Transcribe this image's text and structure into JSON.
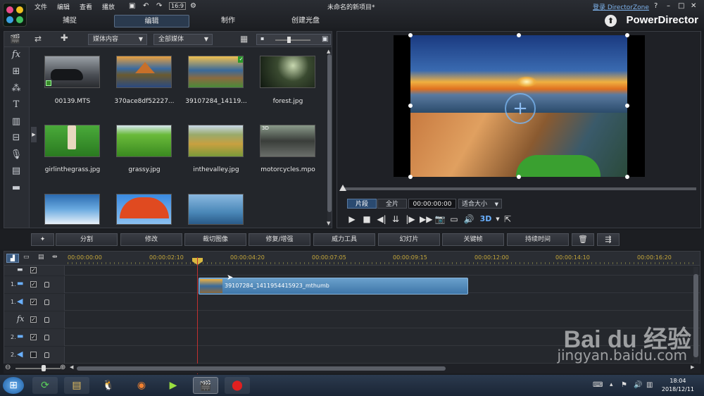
{
  "window": {
    "title": "未命名的新项目*",
    "menus": [
      "文件",
      "编辑",
      "查看",
      "播放"
    ],
    "login": "登录 DirectorZone",
    "help": "?"
  },
  "tabs": [
    "捕捉",
    "编辑",
    "制作",
    "创建光盘"
  ],
  "brand": "PowerDirector",
  "library": {
    "dropdown_content": "媒体内容",
    "dropdown_filter": "全部媒体",
    "items": [
      {
        "name": "00139.MTS"
      },
      {
        "name": "370ace8df52227..."
      },
      {
        "name": "39107284_14119..."
      },
      {
        "name": "forest.jpg"
      },
      {
        "name": "girlinthegrass.jpg"
      },
      {
        "name": "grassy.jpg"
      },
      {
        "name": "inthevalley.jpg"
      },
      {
        "name": "motorcycles.mpo"
      },
      {
        "name": ""
      },
      {
        "name": ""
      },
      {
        "name": ""
      }
    ],
    "badge_3d": "3D"
  },
  "preview": {
    "mode_clip": "片段",
    "mode_movie": "全片",
    "timecode": "00:00:00:00",
    "fit": "适合大小",
    "badge_3d": "3D"
  },
  "edit_toolbar": [
    "分割",
    "修改",
    "裁切图像",
    "修复/增强",
    "威力工具",
    "幻灯片",
    "关键帧",
    "持续时间"
  ],
  "timeline": {
    "timecodes": [
      "00:00:00:00",
      "00:00:02:10",
      "00:00:04:20",
      "00:00:07:05",
      "00:00:09:15",
      "00:00:12:00",
      "00:00:14:10",
      "00:00:16:20"
    ],
    "clip_label": "39107284_1411954415923_mthumb",
    "tracks": [
      {
        "num": "",
        "icon": "video-track-icon"
      },
      {
        "num": "1.",
        "icon": "video-track-icon"
      },
      {
        "num": "1.",
        "icon": "audio-track-icon"
      },
      {
        "num": "",
        "icon": "fx-track-icon"
      },
      {
        "num": "2.",
        "icon": "video-track-icon"
      },
      {
        "num": "2.",
        "icon": "audio-track-icon"
      }
    ]
  },
  "taskbar": {
    "time": "18:04",
    "date": "2018/12/11"
  },
  "watermark": {
    "line1": "Bai du 经验",
    "line2": "jingyan.baidu.com"
  },
  "colors": {
    "accent": "#5a8ec0",
    "timecode": "#c6a83a",
    "playhead": "#c03030"
  }
}
